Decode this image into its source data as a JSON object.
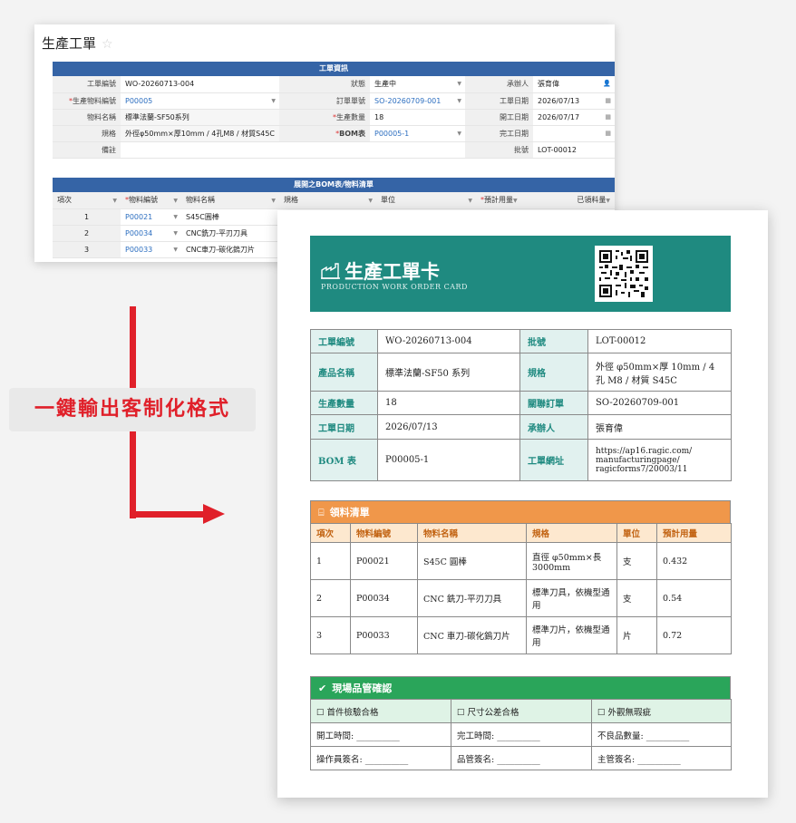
{
  "form": {
    "title": "生產工單",
    "info_header": "工單資訊",
    "fields": {
      "wo_label": "工單編號",
      "wo_value": "WO-20260713-004",
      "status_label": "狀態",
      "status_value": "生產中",
      "handler_label": "承辦人",
      "handler_value": "張育偉",
      "item_code_label": "生產物料編號",
      "item_code_value": "P00005",
      "order_label": "訂單單號",
      "order_value": "SO-20260709-001",
      "wo_date_label": "工單日期",
      "wo_date_value": "2026/07/13",
      "item_name_label": "物料名稱",
      "item_name_value": "標準法蘭-SF50系列",
      "qty_label": "生產數量",
      "qty_value": "18",
      "start_date_label": "開工日期",
      "start_date_value": "2026/07/17",
      "spec_label": "規格",
      "spec_value": "外徑φ50mm×厚10mm / 4孔M8 / 材質S45C",
      "bom_label": "BOM表",
      "bom_value": "P00005-1",
      "finish_date_label": "完工日期",
      "finish_date_value": "",
      "note_label": "備註",
      "note_value": "",
      "lot_label": "批號",
      "lot_value": "LOT-00012"
    },
    "bom_header": "展開之BOM表/物料清單",
    "bom_columns": [
      "項次",
      "物料編號",
      "物料名稱",
      "規格",
      "單位",
      "預計用量",
      "已領料量"
    ],
    "bom_rows": [
      {
        "no": "1",
        "code": "P00021",
        "name": "S45C圓棒"
      },
      {
        "no": "2",
        "code": "P00034",
        "name": "CNC銑刀-平刃刀具"
      },
      {
        "no": "3",
        "code": "P00033",
        "name": "CNC車刀-碳化鎢刀片"
      }
    ]
  },
  "callout": {
    "label": "一鍵輸出客制化格式",
    "accent_color": "#e0202a"
  },
  "card": {
    "title": "生產工單卡",
    "subtitle": "PRODUCTION WORK ORDER CARD",
    "theme_color": "#1f8a80",
    "info": [
      {
        "l1": "工單編號",
        "v1": "WO-20260713-004",
        "l2": "批號",
        "v2": "LOT-00012"
      },
      {
        "l1": "產品名稱",
        "v1": "標準法蘭-SF50 系列",
        "l2": "規格",
        "v2": "外徑 φ50mm×厚 10mm / 4 孔 M8 / 材質 S45C"
      },
      {
        "l1": "生產數量",
        "v1": "18",
        "l2": "關聯訂單",
        "v2": "SO-20260709-001"
      },
      {
        "l1": "工單日期",
        "v1": "2026/07/13",
        "l2": "承辦人",
        "v2": "張育偉"
      },
      {
        "l1": "BOM 表",
        "v1": "P00005-1",
        "l2": "工單網址",
        "v2": "https://ap16.ragic.com/ manufacturingpage/ ragicforms7/20003/11"
      }
    ],
    "materials": {
      "header": "領料清單",
      "header_color": "#f0974a",
      "columns": [
        "項次",
        "物料編號",
        "物料名稱",
        "規格",
        "單位",
        "預計用量"
      ],
      "rows": [
        {
          "no": "1",
          "code": "P00021",
          "name": "S45C 圓棒",
          "spec": "直徑 φ50mm×長 3000mm",
          "unit": "支",
          "qty": "0.432"
        },
        {
          "no": "2",
          "code": "P00034",
          "name": "CNC 銑刀-平刃刀具",
          "spec": "標準刀具，依機型通用",
          "unit": "支",
          "qty": "0.54"
        },
        {
          "no": "3",
          "code": "P00033",
          "name": "CNC 車刀-碳化鎢刀片",
          "spec": "標準刀片，依機型通用",
          "unit": "片",
          "qty": "0.72"
        }
      ]
    },
    "qc": {
      "header": "現場品管確認",
      "header_color": "#2aa55a",
      "checks": [
        "首件檢驗合格",
        "尺寸公差合格",
        "外觀無瑕疵"
      ],
      "row2": [
        "開工時間: __________",
        "完工時間: __________",
        "不良品數量: __________"
      ],
      "row3": [
        "操作員簽名: __________",
        "品管簽名: __________",
        "主管簽名: __________"
      ]
    }
  }
}
